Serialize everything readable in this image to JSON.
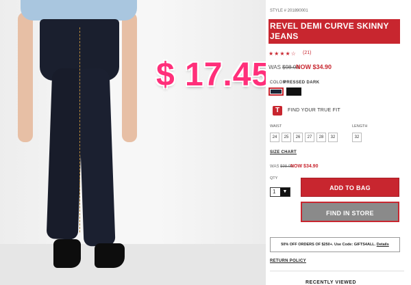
{
  "overlay": {
    "promo_price": "$ 17.45"
  },
  "product": {
    "style_number": "STYLE # 201890001",
    "title": "REVEL DEMI CURVE SKINNY JEANS",
    "stars": "★★★★☆",
    "review_count": "(21)",
    "price": {
      "was_label": "WAS ",
      "was_value": "$98.00",
      "now_label": "NOW $34.90"
    },
    "color": {
      "label": "COLOR",
      "selected_name": "PRESSED DARK",
      "swatches": [
        "#1c2536",
        "#111111"
      ]
    },
    "fit_finder": {
      "icon": "T",
      "label": "FIND YOUR TRUE FIT"
    },
    "waist": {
      "label": "WAIST",
      "sizes": [
        "24",
        "25",
        "26",
        "27",
        "28",
        "32"
      ]
    },
    "length": {
      "label": "LENGTH",
      "sizes": [
        "32"
      ]
    },
    "size_chart_label": "SIZE CHART",
    "price_repeat": {
      "was_label": "WAS ",
      "was_value": "$98.00",
      "now_label": "NOW $34.90"
    },
    "quantity": {
      "label": "QTY",
      "value": "1"
    },
    "add_to_bag_label": "ADD TO BAG",
    "find_in_store_label": "FIND IN STORE",
    "promo_text": "50% OFF ORDERS OF $250+. Use Code: GIFTS4ALL. ",
    "promo_details": "Details",
    "return_policy_label": "RETURN POLICY",
    "recently_viewed_label": "RECENTLY VIEWED"
  },
  "colors": {
    "accent": "#c8262f",
    "overlay_pink": "#ff2f7a",
    "button_gray": "#8a8a8a"
  }
}
